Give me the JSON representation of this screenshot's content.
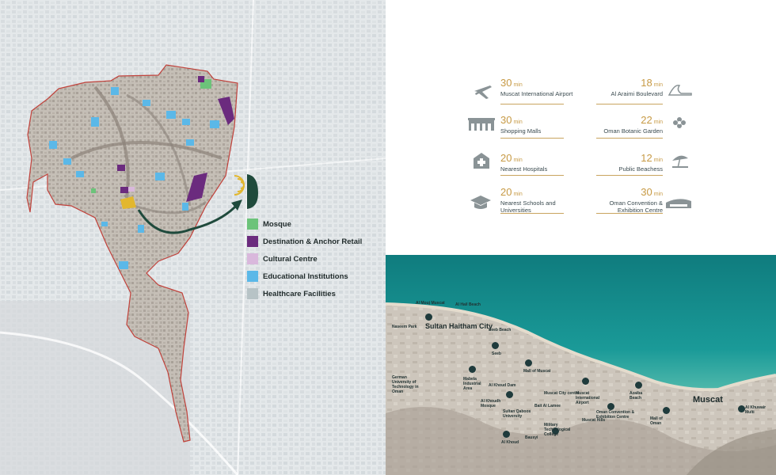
{
  "legend": {
    "items": [
      {
        "label": "Mosque",
        "color": "#6cc37a"
      },
      {
        "label": "Destination & Anchor Retail",
        "color": "#6b2b7e"
      },
      {
        "label": "Cultural Centre",
        "color": "#d9b8dc"
      },
      {
        "label": "Educational Institutions",
        "color": "#5bb8e8"
      },
      {
        "label": "Healthcare Facilities",
        "color": "#b7c3c6"
      }
    ]
  },
  "travel_times": {
    "unit": "min",
    "left": [
      {
        "minutes": "30",
        "label": "Muscat International Airport",
        "icon": "airplane-icon"
      },
      {
        "minutes": "30",
        "label": "Shopping Malls",
        "icon": "shopping-mall-icon"
      },
      {
        "minutes": "20",
        "label": "Nearest Hospitals",
        "icon": "hospital-icon"
      },
      {
        "minutes": "20",
        "label": "Nearest Schools and Universities",
        "icon": "graduation-cap-icon"
      }
    ],
    "right": [
      {
        "minutes": "18",
        "label": "Al Araimi Boulevard",
        "icon": "wave-icon"
      },
      {
        "minutes": "22",
        "label": "Oman Botanic Garden",
        "icon": "flower-icon"
      },
      {
        "minutes": "12",
        "label": "Public Beachess",
        "icon": "beach-umbrella-icon"
      },
      {
        "minutes": "30",
        "label": "Oman Convention & Exhibition Centre",
        "icon": "convention-centre-icon"
      }
    ],
    "accent_color": "#c79a45"
  },
  "coastal_map": {
    "city": "Muscat",
    "district": "Sultan Haitham City",
    "places": [
      "Al Mouj Muscat",
      "Al Hail Beach",
      "Naseem Park",
      "Seeb Beach",
      "Seeb",
      "Mall of Muscat",
      "German University of Technology in Oman",
      "Mabela Industrial Area",
      "Al Khoud Dam",
      "Muscat City centre",
      "Muscat International Airport",
      "Azaiba Beach",
      "Al Khoudh Mosque",
      "Sultan Qaboos University",
      "Bait Al Lamee",
      "Oman Convention & Exhibition Centre",
      "Muscat Hills",
      "Mall of Oman",
      "Military Technological College",
      "Al Khuwair Multi",
      "Bausyi",
      "Al Khoud"
    ]
  }
}
